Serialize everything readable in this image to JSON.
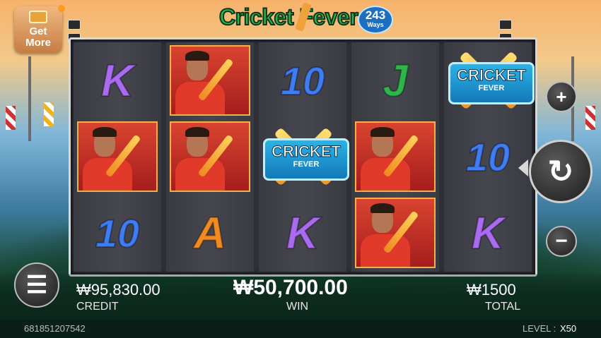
{
  "header": {
    "get_more_label": "Get More",
    "logo_title": "Cricket Fever",
    "logo_badge_number": "243",
    "logo_badge_word": "Ways"
  },
  "reels": [
    [
      "K",
      "player",
      "10"
    ],
    [
      "player",
      "player",
      "A"
    ],
    [
      "10",
      "scatter",
      "K"
    ],
    [
      "J",
      "player",
      "player"
    ],
    [
      "scatter",
      "10",
      "K"
    ]
  ],
  "scatter_text": {
    "line1": "CRICKET",
    "line2": "FEVER"
  },
  "controls": {
    "plus_icon": "+",
    "minus_icon": "−",
    "spin_icon": "↻",
    "menu_icon": "☰"
  },
  "bottom": {
    "credit_value": "₩95,830.00",
    "credit_label": "CREDIT",
    "win_value": "₩50,700.00",
    "win_label": "WIN",
    "total_value": "₩1500",
    "total_label": "TOTAL"
  },
  "footer": {
    "game_id": "681851207542",
    "level_label": "LEVEL :",
    "level_value": "X50"
  },
  "colors": {
    "K": "#a96bf0",
    "10": "#3f7df5",
    "J": "#2fb64a",
    "A": "#f08a22",
    "bottom_bar": "#0c2b1e"
  }
}
